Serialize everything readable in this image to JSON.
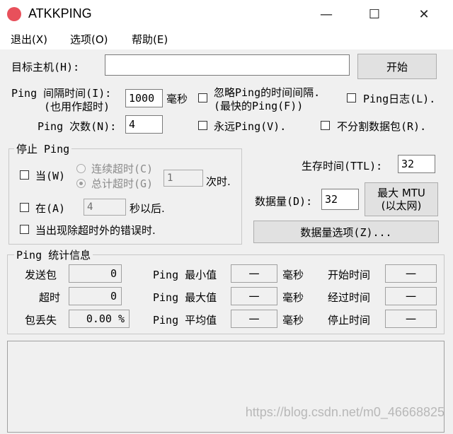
{
  "window": {
    "title": "ATKKPING",
    "minimize": "—",
    "maximize": "☐",
    "close": "✕"
  },
  "menu": [
    "退出(X)",
    "选项(O)",
    "帮助(E)"
  ],
  "target": {
    "label": "目标主机(H):",
    "value": "",
    "start_button": "开始"
  },
  "interval": {
    "label_line1": "Ping 间隔时间(I):",
    "label_line2": "(也用作超时)",
    "value": "1000",
    "unit": "毫秒"
  },
  "ignore_ping_time": {
    "line1": "忽略Ping的时间间隔.",
    "line2": "(最快的Ping(F))",
    "checked": false
  },
  "ping_log": {
    "label": "Ping日志(L).",
    "checked": false
  },
  "ping_count": {
    "label": "Ping 次数(N):",
    "value": "4"
  },
  "forever_ping": {
    "label": "永远Ping(V).",
    "checked": false
  },
  "no_fragment": {
    "label": "不分割数据包(R).",
    "checked": false
  },
  "stop_group": {
    "legend": "停止 Ping",
    "when_label": "当(W)",
    "consecutive_timeout": "连续超时(C)",
    "total_timeout": "总计超时(G)",
    "timeout_count": "1",
    "times_suffix": "次时.",
    "at_label": "在(A)",
    "seconds_value": "4",
    "seconds_suffix": "秒以后.",
    "on_error_label": "当出现除超时外的错误时."
  },
  "ttl": {
    "label": "生存时间(TTL):",
    "value": "32"
  },
  "datasize": {
    "label": "数据量(D):",
    "value": "32",
    "max_mtu_line1": "最大 MTU",
    "max_mtu_line2": "(以太网)",
    "options_button": "数据量选项(Z)..."
  },
  "stats": {
    "legend": "Ping  统计信息",
    "sent_label": "发送包",
    "sent_value": "0",
    "timeout_label": "超时",
    "timeout_value": "0",
    "loss_label": "包丢失",
    "loss_value": "0.00 %",
    "min_label": "Ping 最小值",
    "max_label": "Ping 最大值",
    "avg_label": "Ping 平均值",
    "dash": "一",
    "ms": "毫秒",
    "start_label": "开始时间",
    "elapsed_label": "经过时间",
    "stop_label": "停止时间"
  },
  "watermark": "https://blog.csdn.net/m0_46668825",
  "colors": {
    "app_icon": "#e8505b",
    "window_bg": "#f0f0f0"
  }
}
